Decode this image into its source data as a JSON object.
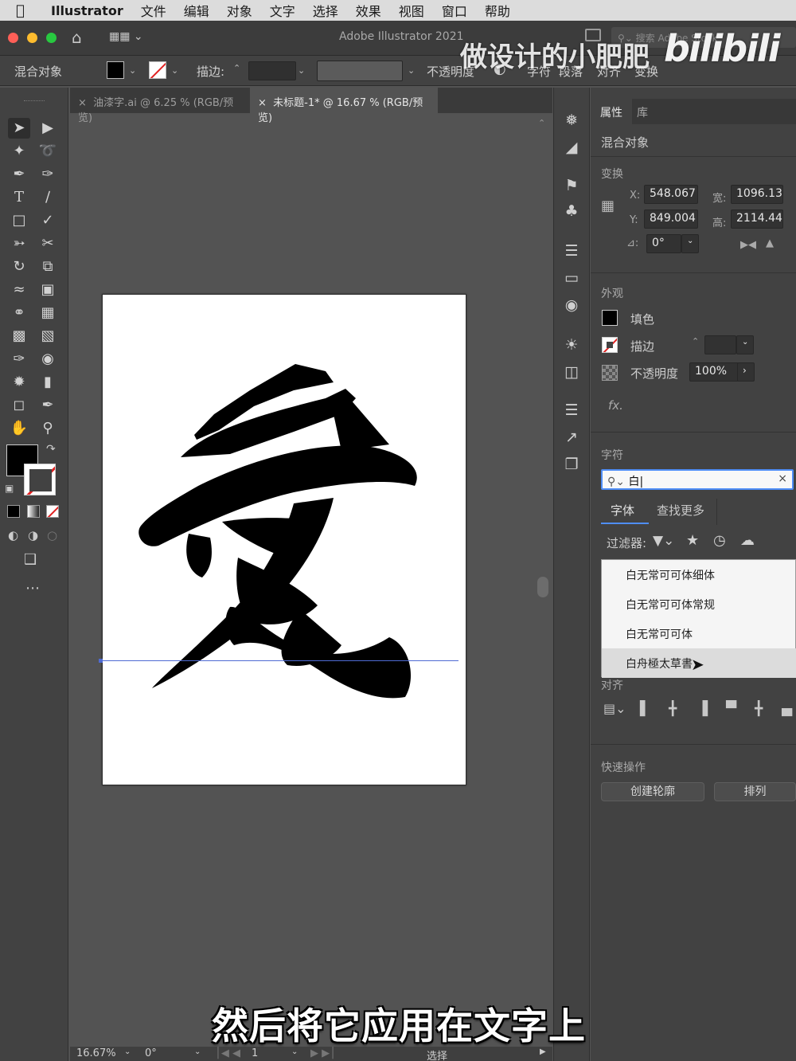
{
  "menubar": {
    "app_name": "Illustrator",
    "items": [
      "文件",
      "编辑",
      "对象",
      "文字",
      "选择",
      "效果",
      "视图",
      "窗口",
      "帮助"
    ]
  },
  "titlebar": {
    "title": "Adobe Illustrator 2021",
    "search_placeholder": "搜索 Adobe Stock"
  },
  "controlbar": {
    "object_type": "混合对象",
    "stroke_label": "描边:",
    "opacity_label": "不透明度",
    "links": [
      "字符",
      "段落",
      "对齐",
      "变换"
    ]
  },
  "doc_tabs": [
    {
      "label": "油漆字.ai @ 6.25 % (RGB/预览)",
      "active": false
    },
    {
      "label": "未标题-1* @ 16.67 % (RGB/预览)",
      "active": true
    }
  ],
  "artwork": {
    "character": "爱"
  },
  "panel": {
    "tabs": [
      "属性",
      "库"
    ],
    "selection_type": "混合对象",
    "transform": {
      "heading": "变换",
      "x_label": "X:",
      "x": "548.067",
      "y_label": "Y:",
      "y": "849.004",
      "w_label": "宽:",
      "w": "1096.13",
      "h_label": "高:",
      "h": "2114.44",
      "angle_label": "⊿:",
      "angle": "0°"
    },
    "appearance": {
      "heading": "外观",
      "fill_label": "填色",
      "stroke_label": "描边",
      "opacity_label": "不透明度",
      "opacity": "100%",
      "fx": "fx."
    },
    "character": {
      "heading": "字符",
      "search_value": "白",
      "subtabs": [
        "字体",
        "查找更多"
      ],
      "filter_label": "过滤器:",
      "fonts": [
        "白无常可可体细体",
        "白无常可可体常规",
        "白无常可可体",
        "白舟極太草書"
      ],
      "hovered_index": 3
    },
    "align": {
      "heading": "对齐"
    },
    "quick_actions": {
      "heading": "快速操作",
      "buttons": [
        "创建轮廓",
        "排列"
      ]
    }
  },
  "statusbar": {
    "zoom": "16.67%",
    "rotation": "0°",
    "artboard": "1",
    "tool": "选择"
  },
  "overlay": {
    "subtitle": "然后将它应用在文字上",
    "watermark": "做设计的小肥肥",
    "logo": "bilibili"
  },
  "colors": {
    "ui_dark": "#424242",
    "canvas_bg": "#535353",
    "guide": "#4f6bd3",
    "focus": "#4f8ef7",
    "stroke_none": "#e02020"
  }
}
